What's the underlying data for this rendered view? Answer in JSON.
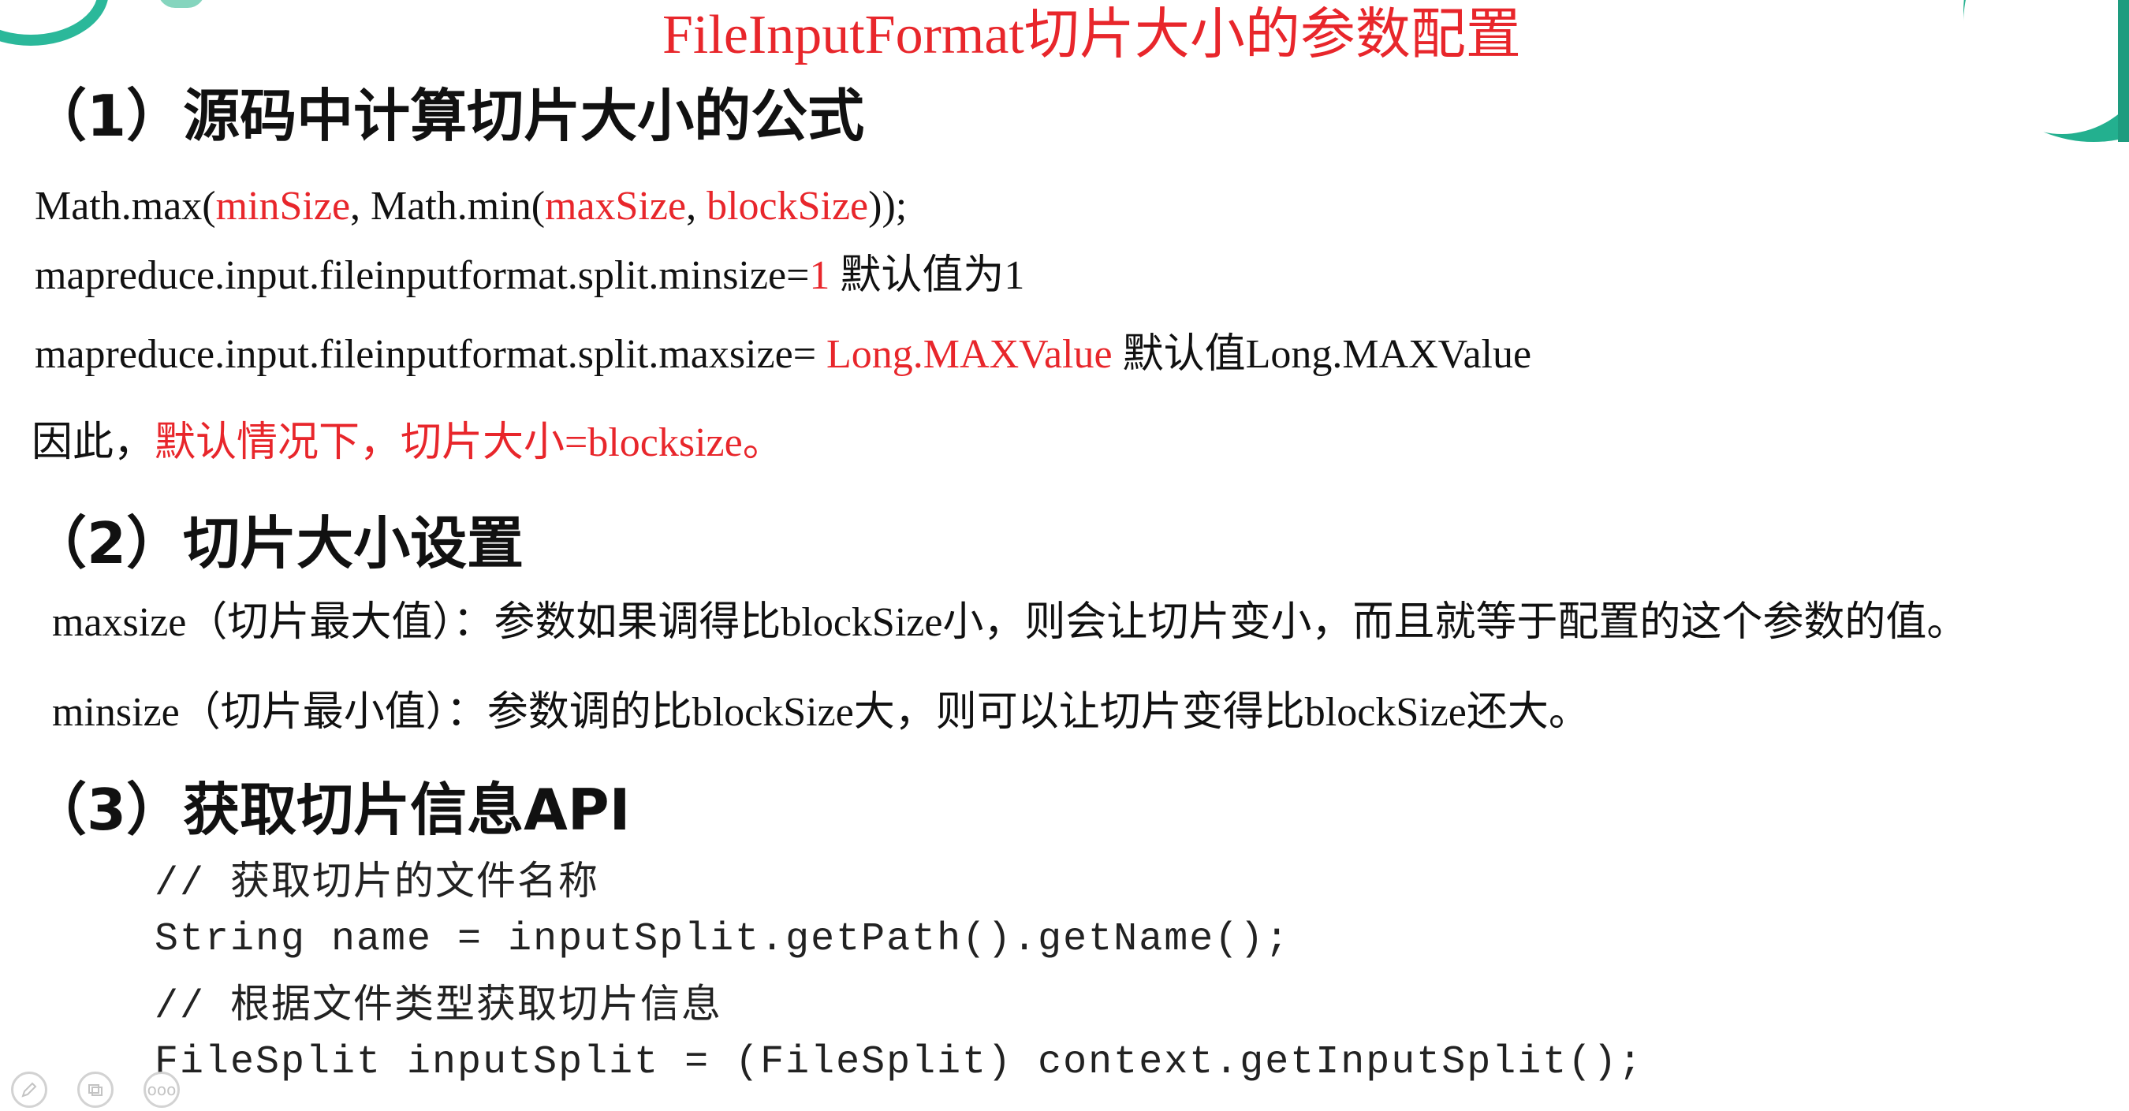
{
  "title": "FileInputFormat切片大小的参数配置",
  "section1": {
    "heading": "（1）源码中计算切片大小的公式",
    "formula": {
      "p1": "Math.max(",
      "r1": "minSize",
      "p2": ", Math.min(",
      "r2": "maxSize",
      "p3": ", ",
      "r3": "blockSize",
      "p4": "));"
    },
    "minsize_line": {
      "p1": "mapreduce.input.fileinputformat.split.minsize=",
      "r1": "1",
      "p2": " 默认值为1"
    },
    "maxsize_line": {
      "p1": "mapreduce.input.fileinputformat.split.maxsize= ",
      "r1": "Long.MAXValue",
      "p2": " 默认值Long.MAXValue"
    },
    "conclusion": {
      "p1": "因此，",
      "r1": "默认情况下，切片大小=blocksize。"
    }
  },
  "section2": {
    "heading": "（2）切片大小设置",
    "maxsize_desc": "maxsize（切片最大值）：参数如果调得比blockSize小，则会让切片变小，而且就等于配置的这个参数的值。",
    "minsize_desc": "minsize（切片最小值）：参数调的比blockSize大，则可以让切片变得比blockSize还大。"
  },
  "section3": {
    "heading": "（3）获取切片信息API",
    "code": [
      "// 获取切片的文件名称",
      "String name = inputSplit.getPath().getName();",
      "// 根据文件类型获取切片信息",
      "FileSplit inputSplit = (FileSplit) context.getInputSplit();"
    ]
  },
  "toolbar": {
    "icons": [
      "pen-icon",
      "slides-icon",
      "more-icon"
    ],
    "more_label": "ooo"
  },
  "colors": {
    "accent": "#e8262b",
    "decoration": "#23b08f"
  }
}
